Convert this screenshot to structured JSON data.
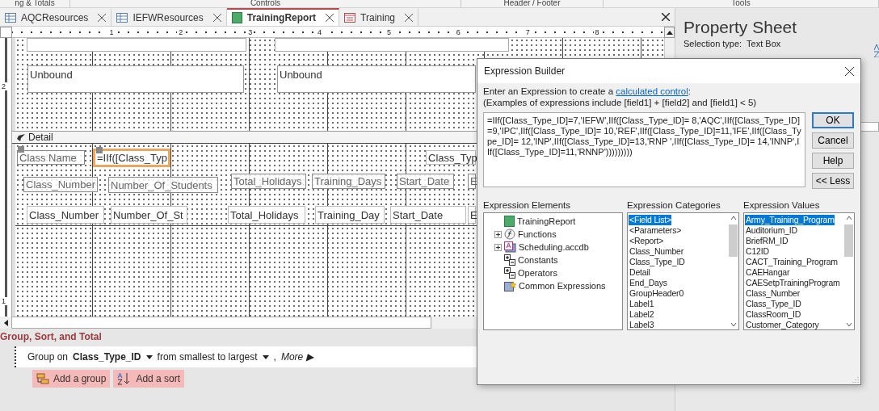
{
  "ribbon_groups": [
    "ng & Totals",
    "Controls",
    "Header / Footer",
    "Tools"
  ],
  "tabs": [
    {
      "label": "AQCResources",
      "kind": "table",
      "selected": false
    },
    {
      "label": "IEFWResources",
      "kind": "table",
      "selected": false
    },
    {
      "label": "TrainingReport",
      "kind": "report",
      "selected": true
    },
    {
      "label": "Training",
      "kind": "form",
      "selected": false
    }
  ],
  "ruler": {
    "horizontal": [
      "1",
      "2",
      "3",
      "4",
      "5",
      "6",
      "7",
      "8"
    ],
    "vertical": [
      "2",
      "1"
    ]
  },
  "report": {
    "header_controls": [
      "Unbound",
      "Unbound"
    ],
    "detail_band": "Detail",
    "detail_controls": [
      {
        "kind": "label",
        "text": "Class Name",
        "selected": false
      },
      {
        "kind": "textbox",
        "text": "=IIf([Class_Typ",
        "selected": true
      },
      {
        "kind": "textbox",
        "text": "Class_Typ",
        "selected": false
      },
      {
        "kind": "label",
        "text": "Class_Number",
        "selected": false
      },
      {
        "kind": "label",
        "text": "Number_Of_Students",
        "selected": false
      },
      {
        "kind": "label",
        "text": "Total_Holidays",
        "selected": false
      },
      {
        "kind": "label",
        "text": "Training_Days",
        "selected": false
      },
      {
        "kind": "label",
        "text": "Start_Date",
        "selected": false
      },
      {
        "kind": "label",
        "text": "E",
        "selected": false
      },
      {
        "kind": "textbox",
        "text": "Class_Number",
        "selected": false
      },
      {
        "kind": "textbox",
        "text": "Number_Of_St",
        "selected": false
      },
      {
        "kind": "textbox",
        "text": "Total_Holidays",
        "selected": false
      },
      {
        "kind": "textbox",
        "text": "Training_Day",
        "selected": false
      },
      {
        "kind": "textbox",
        "text": "Start_Date",
        "selected": false
      },
      {
        "kind": "textbox",
        "text": "E",
        "selected": false
      }
    ]
  },
  "group_sort_total": {
    "title": "Group, Sort, and Total",
    "group_label": "Group on",
    "field": "Class_Type_ID",
    "order": "from smallest to largest",
    "separator": ",",
    "more": "More ▶",
    "add_group": "Add a group",
    "add_sort": "Add a sort"
  },
  "property_sheet": {
    "title": "Property Sheet",
    "selection_label": "Selection type:",
    "selection_value": "Text Box"
  },
  "dialog": {
    "title": "Expression Builder",
    "intro": "Enter an Expression to create a",
    "intro_link": "calculated control",
    "intro_end": ":",
    "examples": "(Examples of expressions include [field1] + [field2] and [field1] < 5)",
    "expression": "=IIf([Class_Type_ID]=7,'IEFW',IIf([Class_Type_ID]= 8,'AQC',IIf([Class_Type_ID]=9,'IPC',IIf([Class_Type_ID]= 10,'REF',IIf([Class_Type_ID]=11,'IFE',IIf([Class_Type_ID]= 12,'INP',IIf([Class_Type_ID]=13,'RNP ',IIf([Class_Type_ID]= 14,'INNP',IIf([Class_Type_ID]=11,'RNNP')))))))))",
    "buttons": [
      {
        "label": "OK",
        "default": true
      },
      {
        "label": "Cancel",
        "default": false
      },
      {
        "label": "Help",
        "default": false
      },
      {
        "label": "<< Less",
        "default": false
      }
    ],
    "elements": {
      "title": "Expression Elements",
      "items": [
        {
          "label": "TrainingReport",
          "kind": "report",
          "expandable": false,
          "selected": false
        },
        {
          "label": "Functions",
          "kind": "function",
          "expandable": true,
          "selected": false
        },
        {
          "label": "Scheduling.accdb",
          "kind": "database",
          "expandable": true,
          "selected": false
        },
        {
          "label": "Constants",
          "kind": "operator",
          "expandable": false,
          "selected": false
        },
        {
          "label": "Operators",
          "kind": "operator",
          "expandable": false,
          "selected": false
        },
        {
          "label": "Common Expressions",
          "kind": "common",
          "expandable": false,
          "selected": false
        }
      ]
    },
    "categories": {
      "title": "Expression Categories",
      "items": [
        {
          "label": "<Field List>",
          "selected": true
        },
        {
          "label": "<Parameters>",
          "selected": false
        },
        {
          "label": "<Report>",
          "selected": false
        },
        {
          "label": "Class_Number",
          "selected": false
        },
        {
          "label": "Class_Type_ID",
          "selected": false
        },
        {
          "label": "Detail",
          "selected": false
        },
        {
          "label": "End_Days",
          "selected": false
        },
        {
          "label": "GroupHeader0",
          "selected": false
        },
        {
          "label": "Label1",
          "selected": false
        },
        {
          "label": "Label2",
          "selected": false
        },
        {
          "label": "Label3",
          "selected": false
        }
      ]
    },
    "values": {
      "title": "Expression Values",
      "items": [
        {
          "label": "Army_Training_Program",
          "selected": true
        },
        {
          "label": "Auditorium_ID",
          "selected": false
        },
        {
          "label": "BriefRM_ID",
          "selected": false
        },
        {
          "label": "C12ID",
          "selected": false
        },
        {
          "label": "CACT_Training_Program",
          "selected": false
        },
        {
          "label": "CAEHangar",
          "selected": false
        },
        {
          "label": "CAESetpTrainingProgram",
          "selected": false
        },
        {
          "label": "Class_Number",
          "selected": false
        },
        {
          "label": "Class_Type_ID",
          "selected": false
        },
        {
          "label": "ClassRoom_ID",
          "selected": false
        },
        {
          "label": "Customer_Category",
          "selected": false
        }
      ]
    }
  }
}
